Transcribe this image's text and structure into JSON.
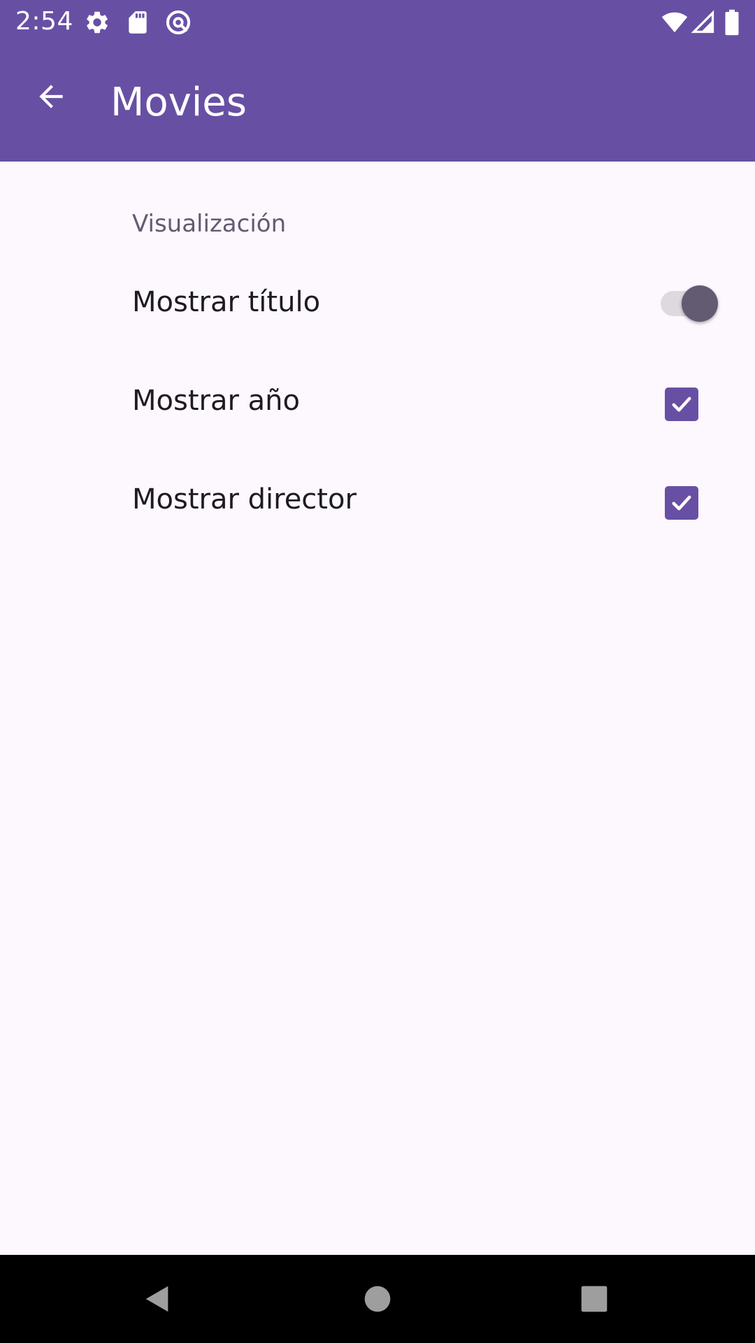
{
  "status_bar": {
    "time": "2:54",
    "left_icons": [
      "gear-icon",
      "sd-card-icon",
      "at-sign-icon"
    ],
    "right_icons": [
      "wifi-icon",
      "cell-signal-icon",
      "battery-icon"
    ]
  },
  "app_bar": {
    "title": "Movies",
    "background": "#6750a4"
  },
  "preferences": {
    "category_title": "Visualización",
    "items": [
      {
        "label": "Mostrar título",
        "control": "switch",
        "checked": true
      },
      {
        "label": "Mostrar año",
        "control": "checkbox",
        "checked": true
      },
      {
        "label": "Mostrar director",
        "control": "checkbox",
        "checked": true
      }
    ]
  },
  "colors": {
    "primary": "#6750a4",
    "surface": "#fdf7fe",
    "on_surface": "#1d1b20",
    "category": "#625b71"
  },
  "nav_bar": {
    "buttons": [
      "back-triangle-icon",
      "home-circle-icon",
      "recents-square-icon"
    ]
  }
}
